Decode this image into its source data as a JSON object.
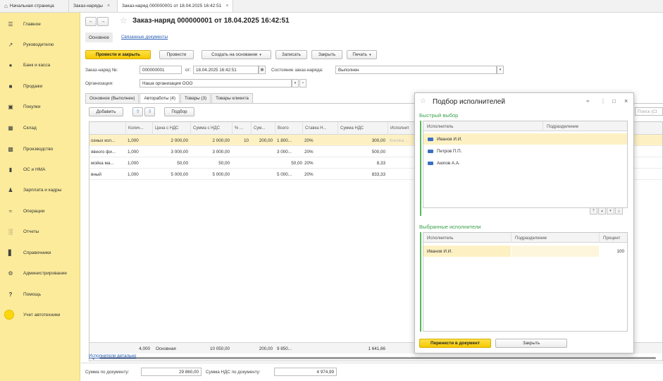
{
  "tabs": [
    {
      "label": "Начальная страница"
    },
    {
      "label": "Заказ-наряды"
    },
    {
      "label": "Заказ-наряд 000000001 от 18.04.2025 16:42:51"
    }
  ],
  "sidebar": {
    "items": [
      {
        "label": "Главное",
        "icon": "menu-icon"
      },
      {
        "label": "Руководителю",
        "icon": "trend-icon"
      },
      {
        "label": "Банк и касса",
        "icon": "bank-icon"
      },
      {
        "label": "Продажи",
        "icon": "bag-icon"
      },
      {
        "label": "Покупки",
        "icon": "cart-icon"
      },
      {
        "label": "Склад",
        "icon": "warehouse-icon"
      },
      {
        "label": "Производство",
        "icon": "factory-icon"
      },
      {
        "label": "ОС и НМА",
        "icon": "truck-icon"
      },
      {
        "label": "Зарплата и кадры",
        "icon": "person-icon"
      },
      {
        "label": "Операции",
        "icon": "operations-icon"
      },
      {
        "label": "Отчеты",
        "icon": "chart-icon"
      },
      {
        "label": "Справочники",
        "icon": "book-icon"
      },
      {
        "label": "Администрирование",
        "icon": "gear-icon"
      },
      {
        "label": "Помощь",
        "icon": "question-icon"
      },
      {
        "label": "Учет автотехники",
        "icon": "circle-icon"
      }
    ]
  },
  "doc": {
    "title": "Заказ-наряд 000000001 от 18.04.2025 16:42:51",
    "subtab_main": "Основное",
    "subtab_related": "Связанные документы",
    "toolbar": {
      "post_close": "Провести и закрыть",
      "post": "Провести",
      "create_based": "Создать на основании",
      "record": "Записать",
      "close": "Закрыть",
      "print": "Печать"
    },
    "fields": {
      "number_label": "Заказ-наряд №:",
      "number_value": "000000001",
      "date_label": "от:",
      "date_value": "18.04.2025 16:42:51",
      "state_label": "Состояние заказ-наряда:",
      "state_value": "Выполнен",
      "org_label": "Организация:",
      "org_value": "Наша организация ООО"
    },
    "form_tabs": [
      "Основное (Выполнен)",
      "Автоработы (4)",
      "Товары (3)",
      "Товары клиента"
    ],
    "table_toolbar": {
      "add": "Добавить",
      "pick": "Подбор",
      "search_placeholder": "Поиск (Ct"
    },
    "columns": [
      "",
      "Колич...",
      "Цена с НДС",
      "Сумма с НДС",
      "% ...",
      "Сум...",
      "Всего",
      "Ставка Н...",
      "Сумма НДС",
      "Исполнит"
    ],
    "rows": [
      {
        "name": "озных кол...",
        "qty": "1,000",
        "price": "2 000,00",
        "sum": "2 000,00",
        "pct": "10",
        "disc": "200,00",
        "total": "1 800...",
        "vat_rate": "20%",
        "vat": "300,00",
        "executor": "Кнопка ..."
      },
      {
        "name": "явного фи...",
        "qty": "1,000",
        "price": "3 000,00",
        "sum": "3 000,00",
        "pct": "",
        "disc": "",
        "total": "3 000...",
        "vat_rate": "20%",
        "vat": "500,00",
        "executor": ""
      },
      {
        "name": "мойка ма...",
        "qty": "1,000",
        "price": "50,00",
        "sum": "50,00",
        "pct": "",
        "disc": "",
        "total": "50,00",
        "vat_rate": "20%",
        "vat": "8,33",
        "executor": ""
      },
      {
        "name": "вный",
        "qty": "1,000",
        "price": "5 000,00",
        "sum": "5 000,00",
        "pct": "",
        "disc": "",
        "total": "5 000...",
        "vat_rate": "20%",
        "vat": "833,33",
        "executor": ""
      }
    ],
    "totals": {
      "qty": "4,000",
      "price": "Основная",
      "sum": "10 050,00",
      "disc": "200,00",
      "total": "9 850...",
      "vat": "1 641,66"
    },
    "executors_link": "Исполнители детально",
    "footer": {
      "sum_label": "Сумма по документу:",
      "sum_value": "29 860,00",
      "vat_label": "Сумма НДС по документу:",
      "vat_value": "4 974,99"
    }
  },
  "dialog": {
    "title": "Подбор исполнителей",
    "quick_title": "Быстрый выбор",
    "quick_columns": [
      "Исполнитель",
      "Подразделение"
    ],
    "quick_rows": [
      {
        "name": "Иванов И.И."
      },
      {
        "name": "Петров П.П."
      },
      {
        "name": "Аюпов А.А."
      }
    ],
    "selected_title": "Выбранные исполнители",
    "selected_columns": [
      "Исполнитель",
      "Подразделение",
      "Процент"
    ],
    "selected_rows": [
      {
        "name": "Иванов И.И.",
        "dept": "",
        "pct": "100"
      }
    ],
    "transfer_button": "Перенести в документ",
    "close_button": "Закрыть"
  },
  "colors": {
    "sidebar": "#fbeb9b",
    "accent_yellow": "#f5c800",
    "green": "#3aa14b",
    "link": "#2b5fb3",
    "selected_row": "#fdf1c4"
  }
}
